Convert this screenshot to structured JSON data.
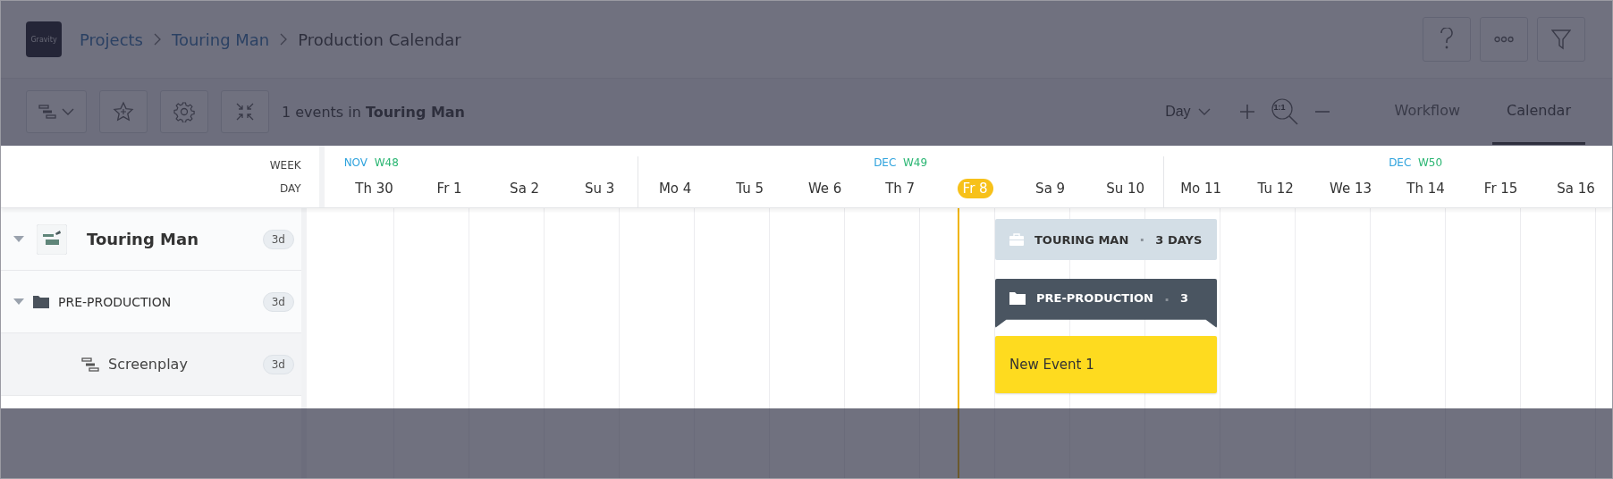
{
  "header": {
    "logo": "Gravity",
    "breadcrumb": [
      {
        "label": "Projects",
        "link": true
      },
      {
        "label": "Touring Man",
        "link": true
      },
      {
        "label": "Production Calendar",
        "link": false
      }
    ]
  },
  "toolbar": {
    "summary": "1 events in **Touring Man**",
    "scale": "Day",
    "zoom_reset": "1:1",
    "tabs": [
      {
        "label": "Workflow",
        "selected": false
      },
      {
        "label": "Calendar",
        "selected": true
      }
    ]
  },
  "calendar": {
    "week_label": "WEEK",
    "day_label": "DAY",
    "weeks": [
      {
        "month": "NOV",
        "week": "W48"
      },
      {
        "month": "DEC",
        "week": "W49"
      },
      {
        "month": "DEC",
        "week": "W50"
      }
    ],
    "days": [
      {
        "label": "Th 30",
        "selected": false
      },
      {
        "label": "Fr 1",
        "selected": false
      },
      {
        "label": "Sa 2",
        "selected": false
      },
      {
        "label": "Su 3",
        "selected": false
      },
      {
        "label": "Mo 4",
        "selected": false
      },
      {
        "label": "Tu 5",
        "selected": false
      },
      {
        "label": "We 6",
        "selected": false
      },
      {
        "label": "Th 7",
        "selected": false
      },
      {
        "label": "Fr 8",
        "selected": true
      },
      {
        "label": "Sa 9",
        "selected": false
      },
      {
        "label": "Su 10",
        "selected": false
      },
      {
        "label": "Mo 11",
        "selected": false
      },
      {
        "label": "Tu 12",
        "selected": false
      },
      {
        "label": "We 13",
        "selected": false
      },
      {
        "label": "Th 14",
        "selected": false
      },
      {
        "label": "Fr 15",
        "selected": false
      },
      {
        "label": "Sa 16",
        "selected": false
      }
    ],
    "rows": [
      {
        "kind": "project",
        "name": "Touring Man",
        "duration": "3d",
        "expanded": true,
        "thumbnail": {
          "kind": "picture"
        },
        "bar": {
          "title": "TOURING MAN",
          "separator": "·",
          "info": "3 DAYS"
        },
        "children": [
          {
            "kind": "group",
            "name": "PRE-PRODUCTION",
            "duration": "3d",
            "expanded": true,
            "bar": {
              "title": "PRE-PRODUCTION",
              "separator": "·",
              "info": "3"
            },
            "children": [
              {
                "kind": "task",
                "name": "Screenplay",
                "duration": "3d",
                "bar": {
                  "title": "New Event 1"
                }
              }
            ]
          }
        ]
      }
    ]
  }
}
